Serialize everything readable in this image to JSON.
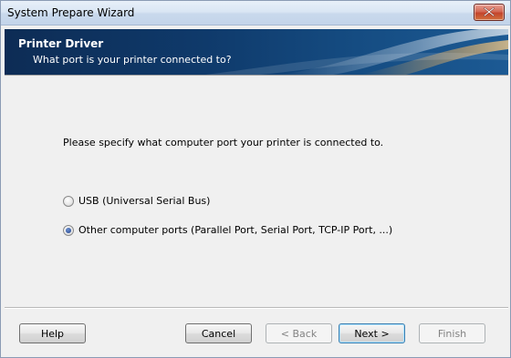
{
  "window": {
    "title": "System Prepare Wizard"
  },
  "banner": {
    "title": "Printer Driver",
    "subtitle": "What port is your printer connected to?"
  },
  "main": {
    "instruction": "Please specify what computer port your printer is connected to.",
    "options": [
      {
        "label": "USB (Universal Serial Bus)",
        "selected": false
      },
      {
        "label": "Other computer ports (Parallel Port, Serial Port, TCP-IP Port, ...)",
        "selected": true
      }
    ]
  },
  "buttons": {
    "help": "Help",
    "cancel": "Cancel",
    "back": "< Back",
    "next": "Next >",
    "finish": "Finish"
  },
  "icons": {
    "close": "close-icon"
  },
  "colors": {
    "banner_bg": "#0f3a6b",
    "banner_text": "#ffffff",
    "close_button": "#c3442c"
  }
}
